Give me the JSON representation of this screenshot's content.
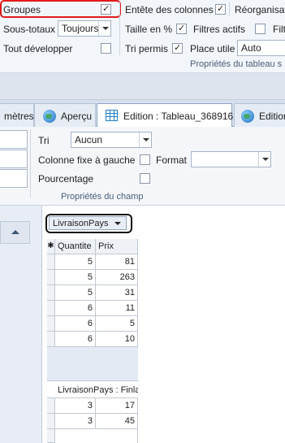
{
  "ribbon": {
    "groupes": "Groupes",
    "sous_totaux": "Sous-totaux",
    "sous_totaux_value": "Toujours",
    "tout_developper": "Tout développer",
    "entete_colonnes": "Entête des colonnes",
    "reorganisation": "Réorganisati",
    "taille_pct": "Taille en %",
    "filtres_actifs": "Filtres actifs",
    "filtr": "Filtr",
    "tri_permis": "Tri permis",
    "place_utile": "Place utile",
    "place_utile_value": "Auto",
    "section_caption": "Propriétés du tableau s"
  },
  "tabs": [
    {
      "label": "mètres"
    },
    {
      "label": "Aperçu"
    },
    {
      "label": "Edition : Tableau_368916"
    },
    {
      "label": "Edition"
    }
  ],
  "field_props": {
    "tri_label": "Tri",
    "tri_value": "Aucun",
    "colonne_fixe": "Colonne fixe à gauche",
    "format_label": "Format",
    "format_value": "",
    "pourcentage": "Pourcentage",
    "caption": "Propriétés du champ"
  },
  "pivot": {
    "field_button": "LivraisonPays",
    "headers": [
      "Quantite",
      "Prix"
    ],
    "star": "✱",
    "rows1": [
      {
        "q": "5",
        "p": "81"
      },
      {
        "q": "5",
        "p": "263"
      },
      {
        "q": "5",
        "p": "31"
      },
      {
        "q": "6",
        "p": "11"
      },
      {
        "q": "6",
        "p": "5"
      },
      {
        "q": "6",
        "p": "10"
      }
    ],
    "group_label": "LivraisonPays : Finla",
    "rows2": [
      {
        "q": "3",
        "p": "17"
      },
      {
        "q": "3",
        "p": "45"
      }
    ]
  },
  "colors": {
    "annotation_red": "#e31b1b",
    "annotation_black": "#111111",
    "accent": "#1d7ec7"
  }
}
